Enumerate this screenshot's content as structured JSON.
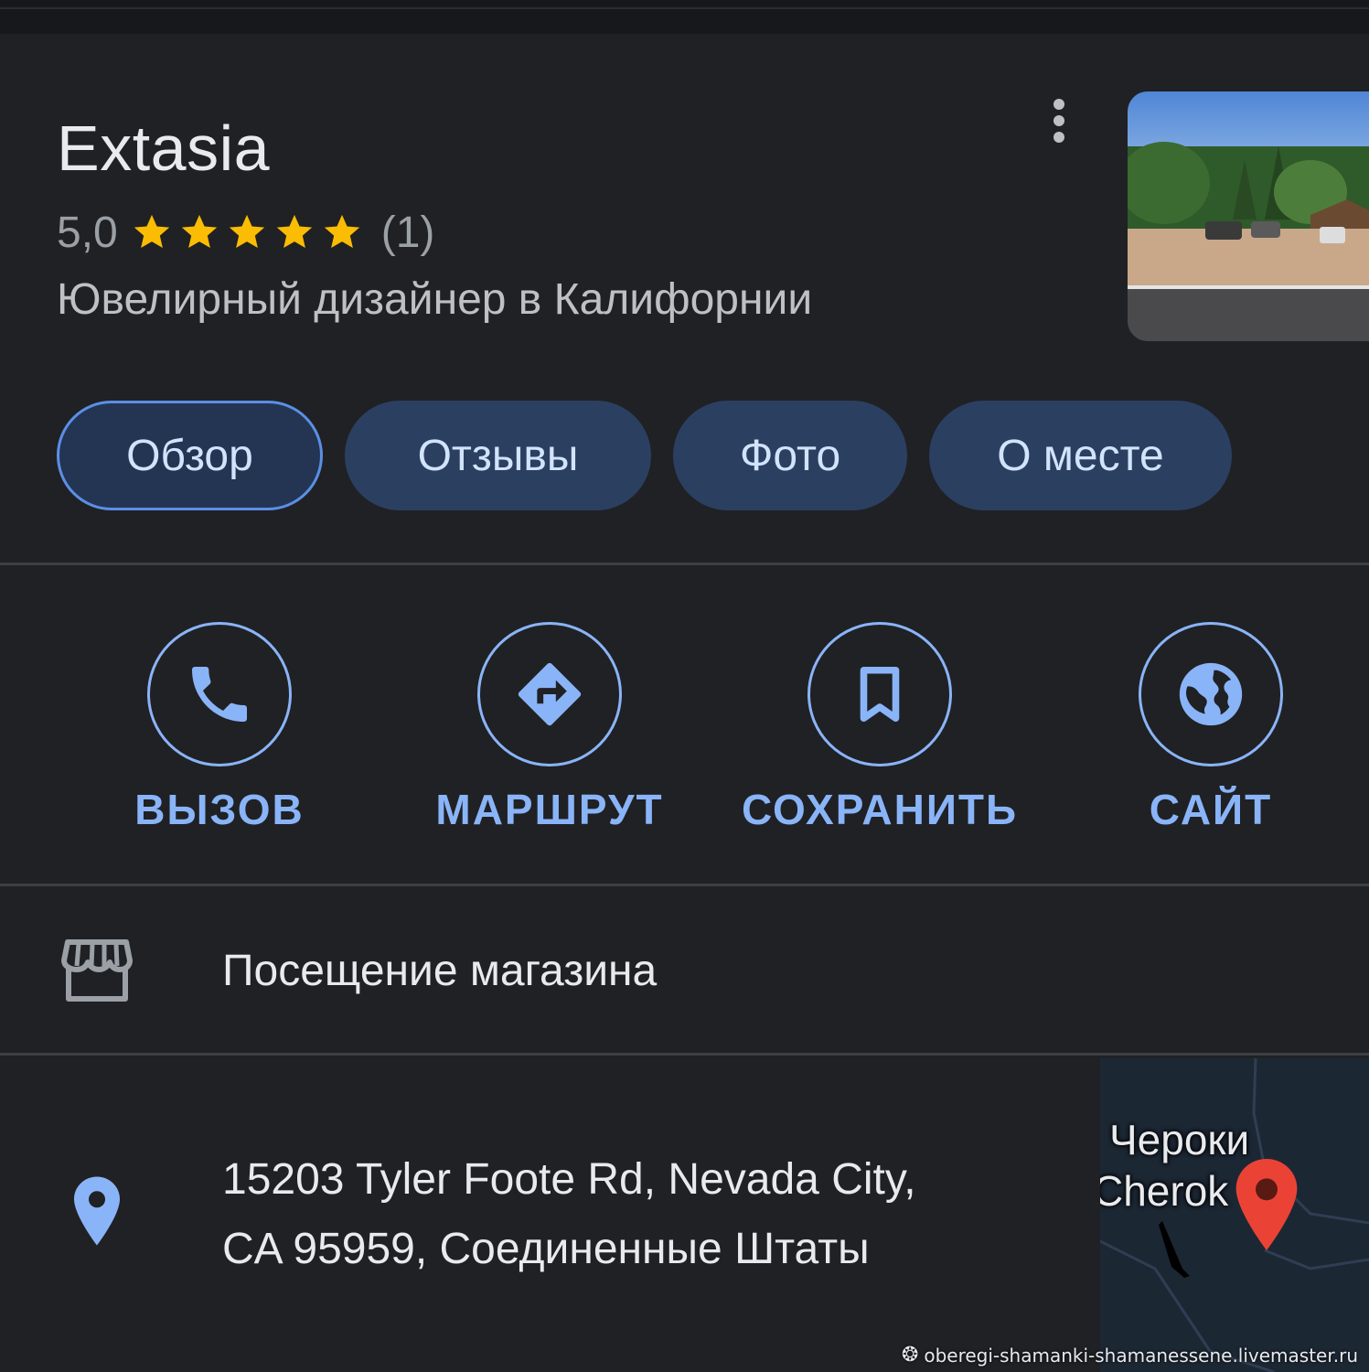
{
  "place": {
    "name": "Extasia",
    "rating": "5,0",
    "stars": 5,
    "review_count": "(1)",
    "category": "Ювелирный дизайнер в Калифорнии"
  },
  "tabs": [
    {
      "label": "Обзор",
      "active": true
    },
    {
      "label": "Отзывы",
      "active": false
    },
    {
      "label": "Фото",
      "active": false
    },
    {
      "label": "О месте",
      "active": false
    }
  ],
  "actions": [
    {
      "label": "ВЫЗОВ",
      "icon": "phone-icon"
    },
    {
      "label": "МАРШРУТ",
      "icon": "directions-icon"
    },
    {
      "label": "СОХРАНИТЬ",
      "icon": "bookmark-icon"
    },
    {
      "label": "САЙТ",
      "icon": "globe-icon"
    }
  ],
  "details": {
    "store_visit": "Посещение магазина",
    "address_line1": "15203 Tyler Foote Rd, Nevada City,",
    "address_line2": "CA 95959, Соединенные Штаты"
  },
  "map": {
    "label_ru": "Чероки",
    "label_en": "Cherok"
  },
  "watermark": "oberegi-shamanki-shamanessene.livemaster.ru",
  "colors": {
    "background": "#202124",
    "accent": "#8ab4f8",
    "tab_bg": "#2b3f61",
    "star": "#fbbc04",
    "pin_red": "#ea4335"
  }
}
